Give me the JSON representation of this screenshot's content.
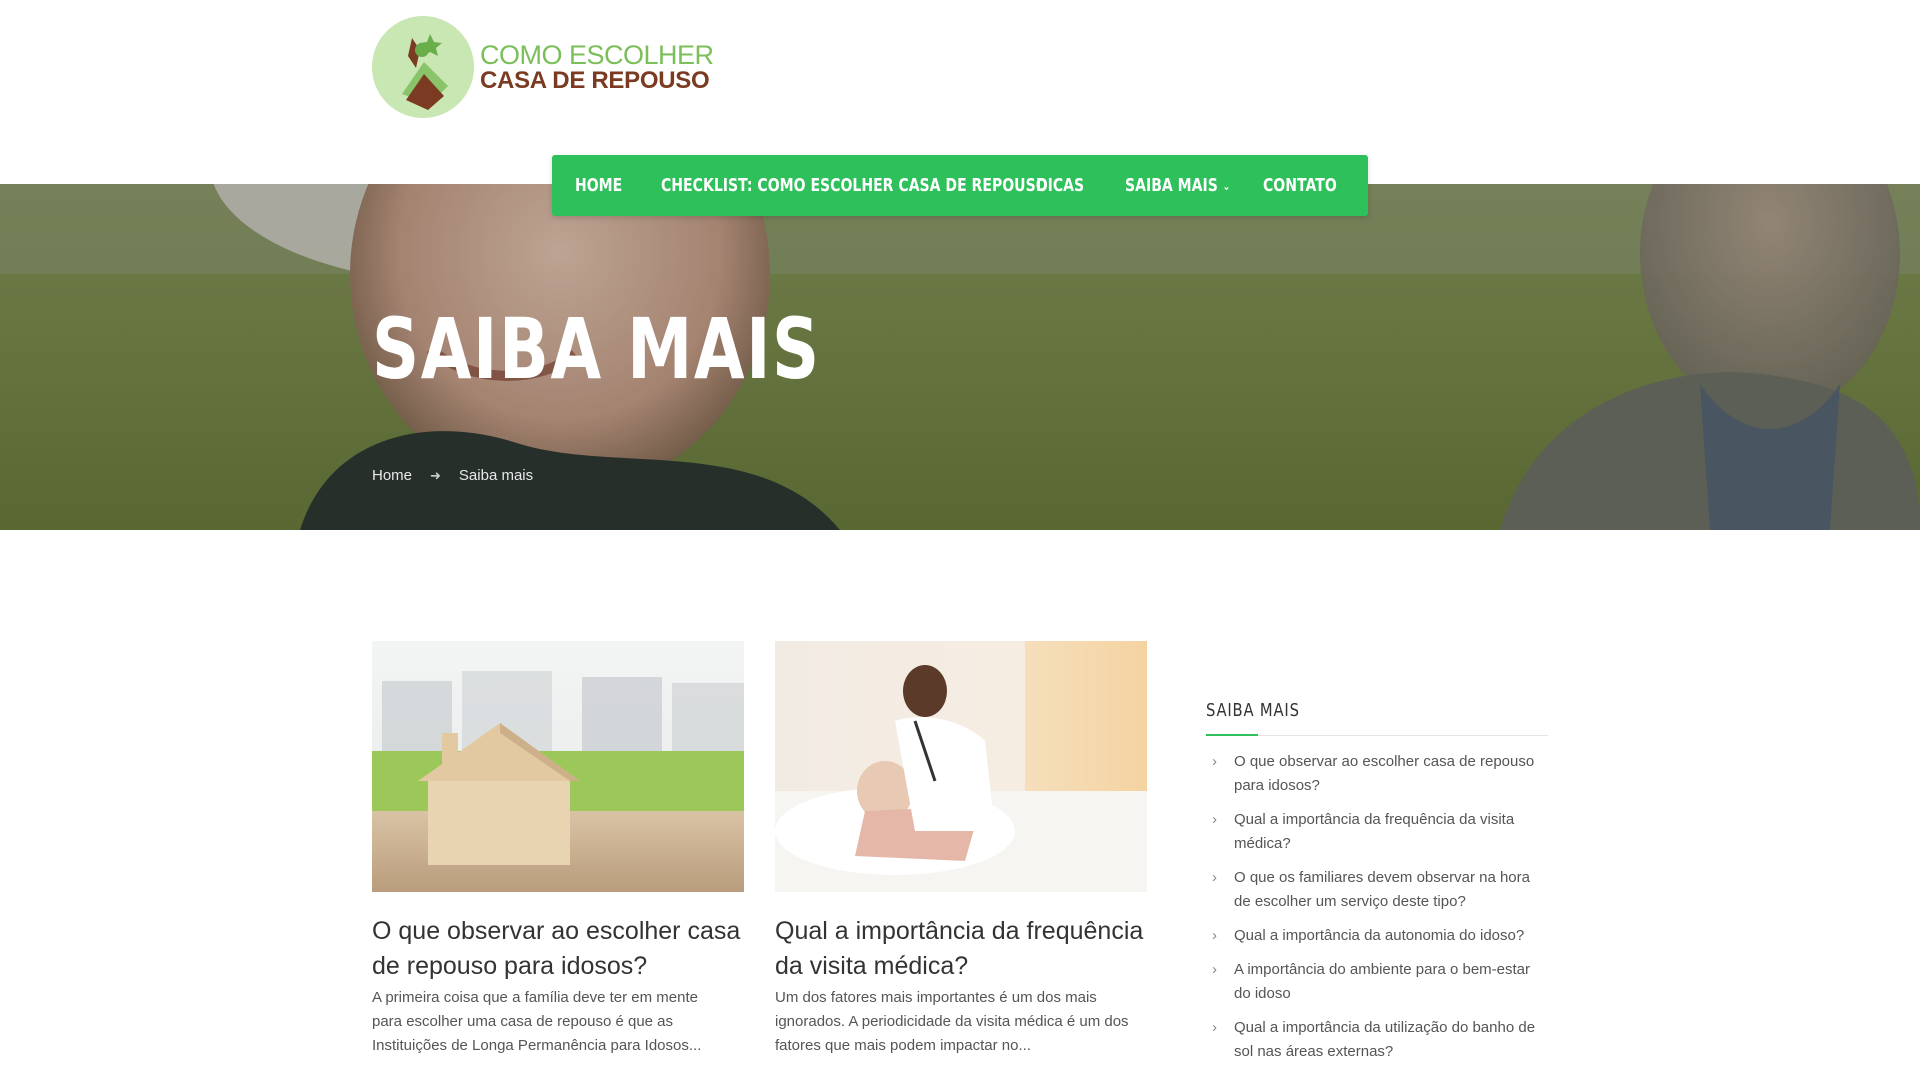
{
  "logo": {
    "line1": "COMO ESCOLHER",
    "line2": "CASA DE REPOUSO"
  },
  "nav": {
    "items": [
      {
        "label": "HOME"
      },
      {
        "label": "CHECKLIST: COMO ESCOLHER CASA DE REPOUSO"
      },
      {
        "label": "DICAS"
      },
      {
        "label": "SAIBA MAIS"
      },
      {
        "label": "CONTATO"
      }
    ]
  },
  "hero": {
    "title": "SAIBA MAIS",
    "breadcrumb": {
      "home": "Home",
      "current": "Saiba mais"
    }
  },
  "posts": [
    {
      "title": "O que observar ao escolher casa de repouso para idosos?",
      "excerpt": "A primeira coisa que a família deve ter em mente para escolher uma casa de repouso é que as Instituições de Longa Permanência para Idosos..."
    },
    {
      "title": "Qual a importância da frequência da visita médica?",
      "excerpt": "Um dos fatores mais importantes é um dos mais ignorados. A periodicidade da visita médica é um dos fatores que mais podem impactar no..."
    }
  ],
  "sidebar": {
    "title": "SAIBA MAIS",
    "items": [
      {
        "label": "O que observar ao escolher casa de repouso para idosos?"
      },
      {
        "label": "Qual a importância da frequência da visita médica?"
      },
      {
        "label": "O que os familiares devem observar na hora de escolher um serviço deste tipo?"
      },
      {
        "label": "Qual a importância da autonomia do idoso?"
      },
      {
        "label": "A importância do ambiente para o bem-estar do idoso"
      },
      {
        "label": "Qual a importância da utilização do banho de sol nas áreas externas?"
      }
    ]
  },
  "colors": {
    "accent": "#2ec05a",
    "logo_green": "#7bbf5a",
    "logo_brown": "#7a3b22"
  }
}
